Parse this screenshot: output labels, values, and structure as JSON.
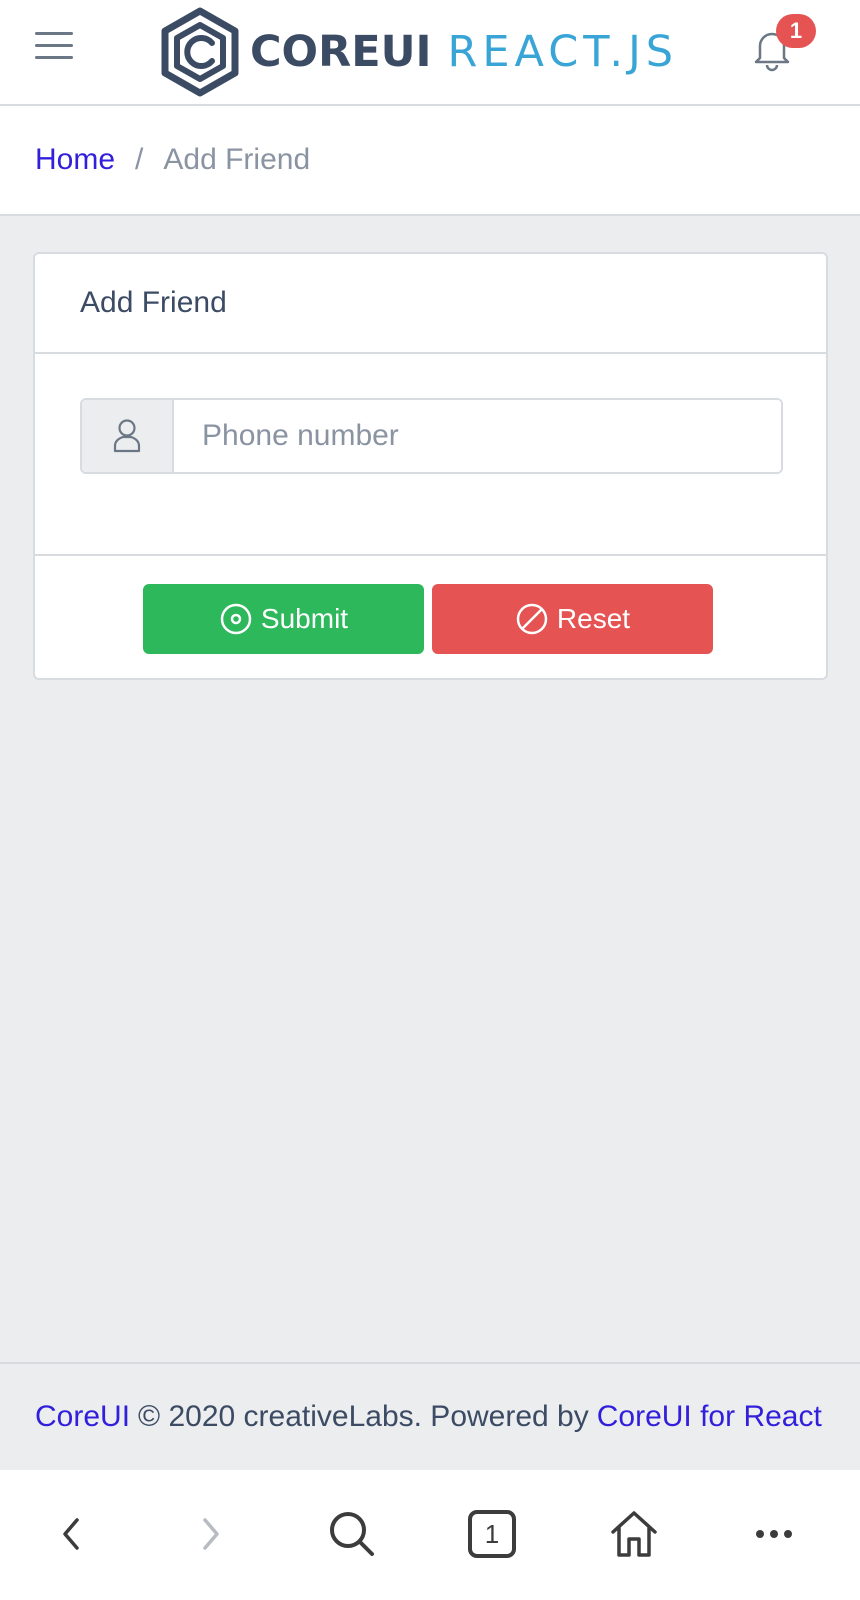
{
  "header": {
    "logo_core": "COREUI",
    "logo_react": "REACT.JS",
    "notification_count": "1",
    "menu_icon": "hamburger-menu-icon",
    "bell_icon": "bell-icon"
  },
  "breadcrumb": {
    "home": "Home",
    "separator": "/",
    "current": "Add Friend"
  },
  "card": {
    "title": "Add Friend",
    "input_icon": "user-icon",
    "input_placeholder": "Phone number",
    "input_value": "",
    "submit_label": "Submit",
    "reset_label": "Reset"
  },
  "footer": {
    "brand_link": "CoreUI",
    "text": "© 2020 creativeLabs. Powered by",
    "powered_link": "CoreUI for React"
  },
  "browser": {
    "tab_count": "1",
    "icons": [
      "back-icon",
      "forward-icon",
      "search-icon",
      "tabs-icon",
      "home-icon",
      "more-icon"
    ]
  },
  "colors": {
    "primary": "#321fdb",
    "success": "#2eb85c",
    "danger": "#e55353",
    "info": "#39a5d6",
    "dark": "#3c4b64",
    "background": "#ebedef"
  }
}
